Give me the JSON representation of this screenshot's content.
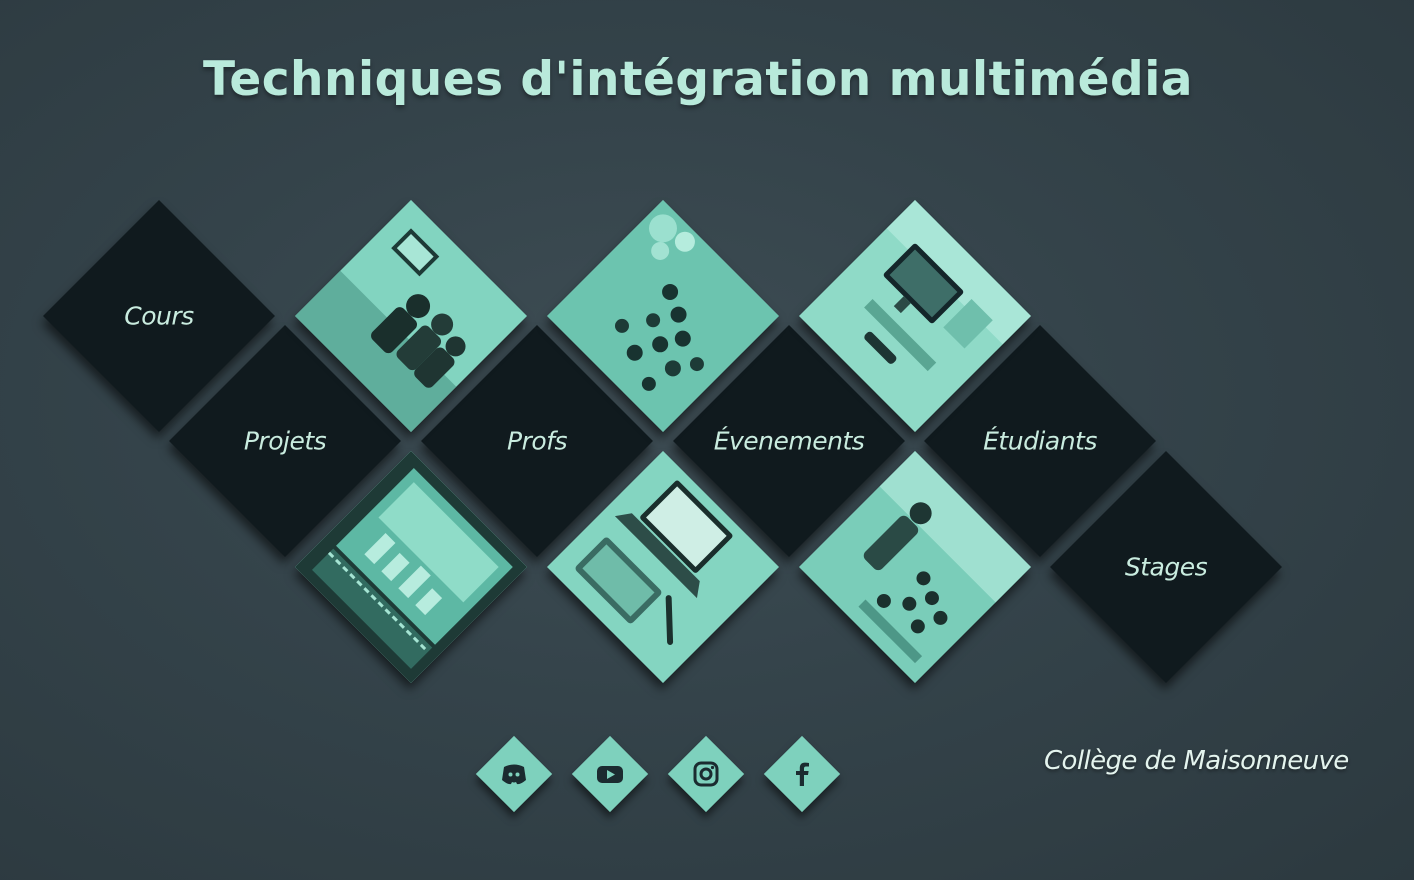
{
  "header": {
    "title": "Techniques d'intégration multimédia"
  },
  "nav": {
    "items": [
      {
        "label": "Cours"
      },
      {
        "label": "Projets"
      },
      {
        "label": "Profs"
      },
      {
        "label": "Évenements"
      },
      {
        "label": "Étudiants"
      },
      {
        "label": "Stages"
      }
    ]
  },
  "photos": [
    {
      "icon": "students-group-photo"
    },
    {
      "icon": "event-crowd-photo"
    },
    {
      "icon": "computer-lab-photo"
    },
    {
      "icon": "projection-screen-photo"
    },
    {
      "icon": "laptop-workstation-photo"
    },
    {
      "icon": "classroom-photo"
    }
  ],
  "social": [
    {
      "icon": "discord-icon"
    },
    {
      "icon": "youtube-icon"
    },
    {
      "icon": "instagram-icon"
    },
    {
      "icon": "facebook-icon"
    }
  ],
  "footer": {
    "college": "Collège de Maisonneuve"
  },
  "colors": {
    "background": "#34434a",
    "accent": "#7ed1bd",
    "title": "#b9eadb",
    "tile_dark": "#101a1e",
    "tile_text": "#c9ecdf"
  }
}
